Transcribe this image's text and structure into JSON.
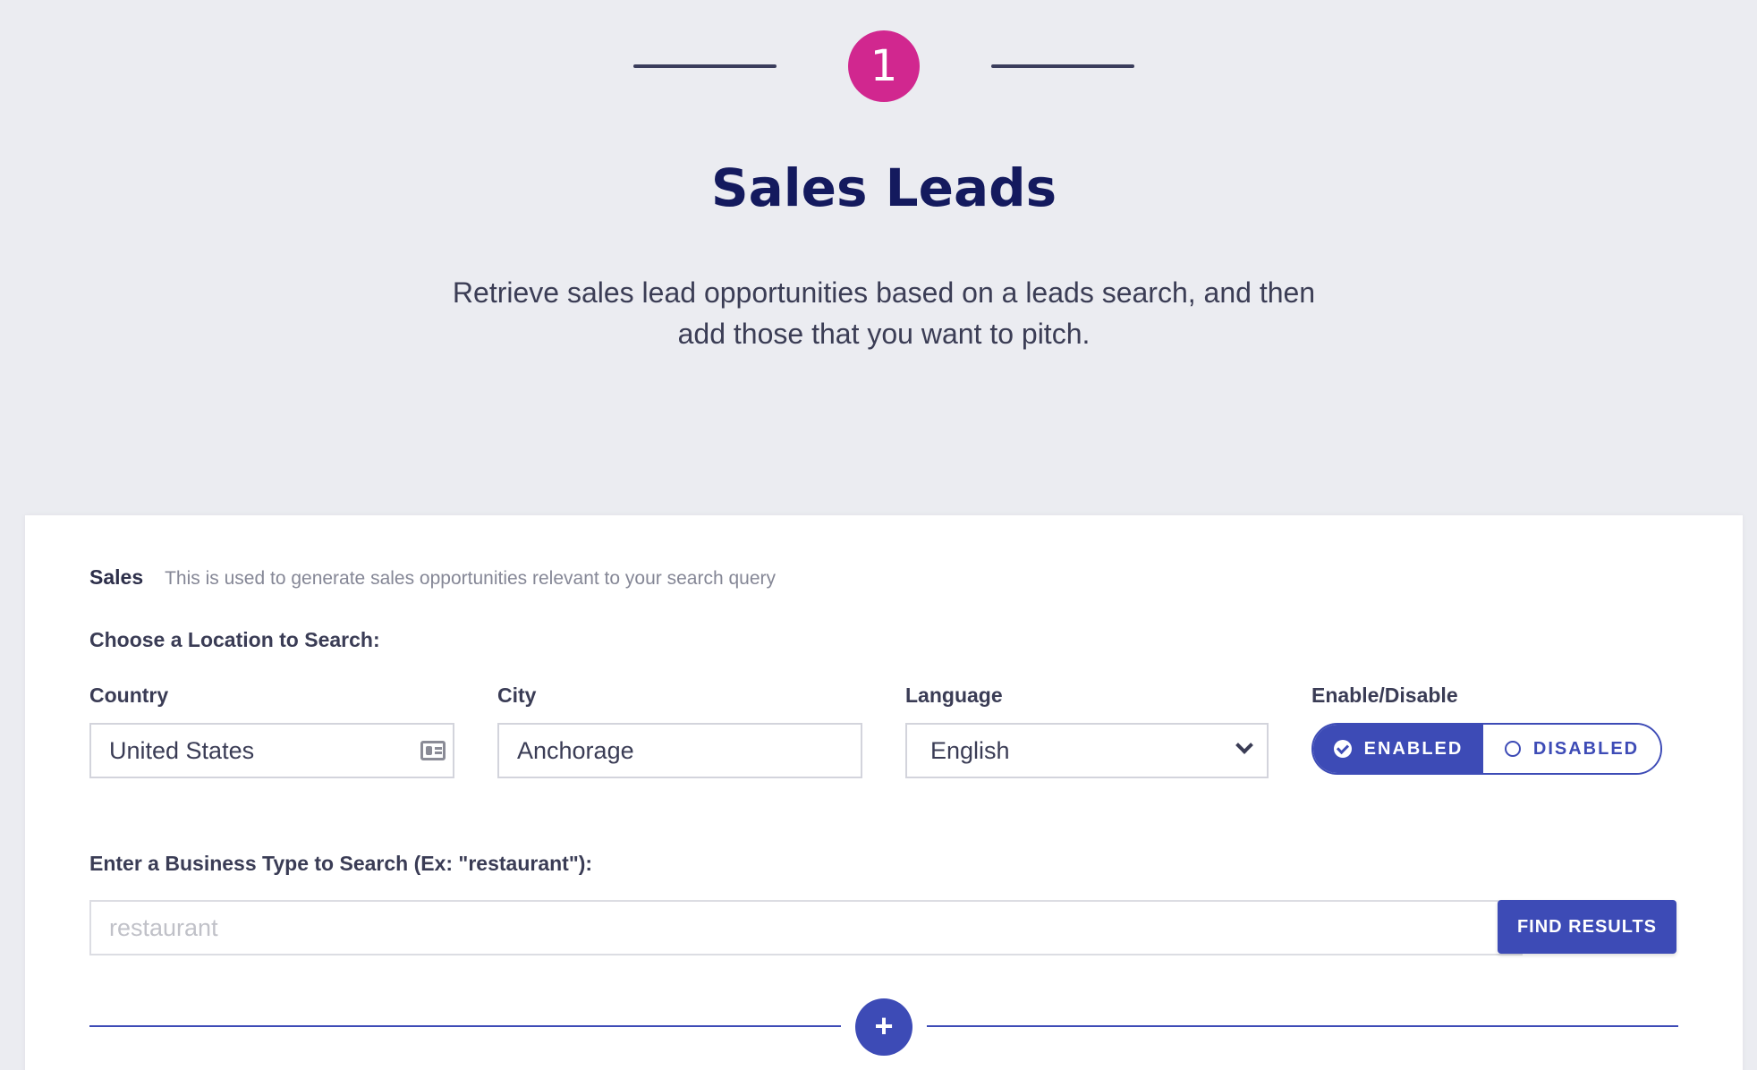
{
  "step": {
    "number": "1"
  },
  "header": {
    "title": "Sales Leads",
    "description": "Retrieve sales lead opportunities based on a leads search, and then add those that you want to pitch."
  },
  "card": {
    "heading": "Sales",
    "subheading": "This is used to generate sales opportunities relevant to your search query",
    "location_label": "Choose a Location to Search:",
    "fields": {
      "country": {
        "label": "Country",
        "value": "United States",
        "icon": "contact-card-icon"
      },
      "city": {
        "label": "City",
        "value": "Anchorage"
      },
      "language": {
        "label": "Language",
        "value": "English"
      },
      "toggle": {
        "label": "Enable/Disable",
        "enabled": "ENABLED",
        "disabled": "DISABLED",
        "selected": "ENABLED"
      }
    },
    "business": {
      "label": "Enter a Business Type to Search (Ex: \"restaurant\"):",
      "placeholder": "restaurant",
      "button": "FIND RESULTS"
    },
    "add_icon": "plus-icon"
  },
  "colors": {
    "accent": "#3d4bb6",
    "step": "#d1278f",
    "title": "#141a5e",
    "background": "#ebecf1"
  }
}
